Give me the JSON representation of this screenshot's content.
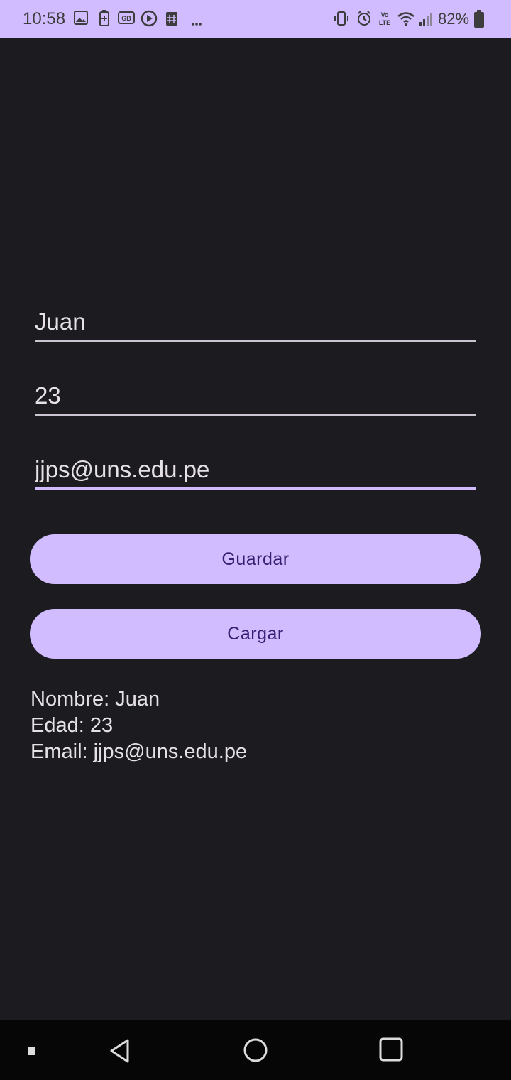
{
  "status_bar": {
    "time": "10:58",
    "battery_percent": "82%",
    "left_icons": [
      "gallery-icon",
      "battery-saver-icon",
      "gb-app-icon",
      "play-icon",
      "hash-app-icon",
      "more-dots-icon"
    ],
    "right_icons": [
      "vibrate-icon",
      "alarm-icon",
      "volte-icon",
      "wifi-icon",
      "signal-icon",
      "battery-icon"
    ]
  },
  "form": {
    "name_value": "Juan",
    "age_value": "23",
    "email_value": "jjps@uns.edu.pe"
  },
  "buttons": {
    "save_label": "Guardar",
    "load_label": "Cargar"
  },
  "result": {
    "name_line": "Nombre: Juan",
    "age_line": "Edad: 23",
    "email_line": "Email: jjps@uns.edu.pe"
  },
  "nav_bar": {
    "items": [
      "recent-apps-dot-icon",
      "back-icon",
      "home-icon",
      "overview-icon"
    ]
  },
  "colors": {
    "accent": "#d0bcfe",
    "background": "#1c1b20",
    "button_text": "#381e72",
    "text": "#e6e1e5"
  }
}
